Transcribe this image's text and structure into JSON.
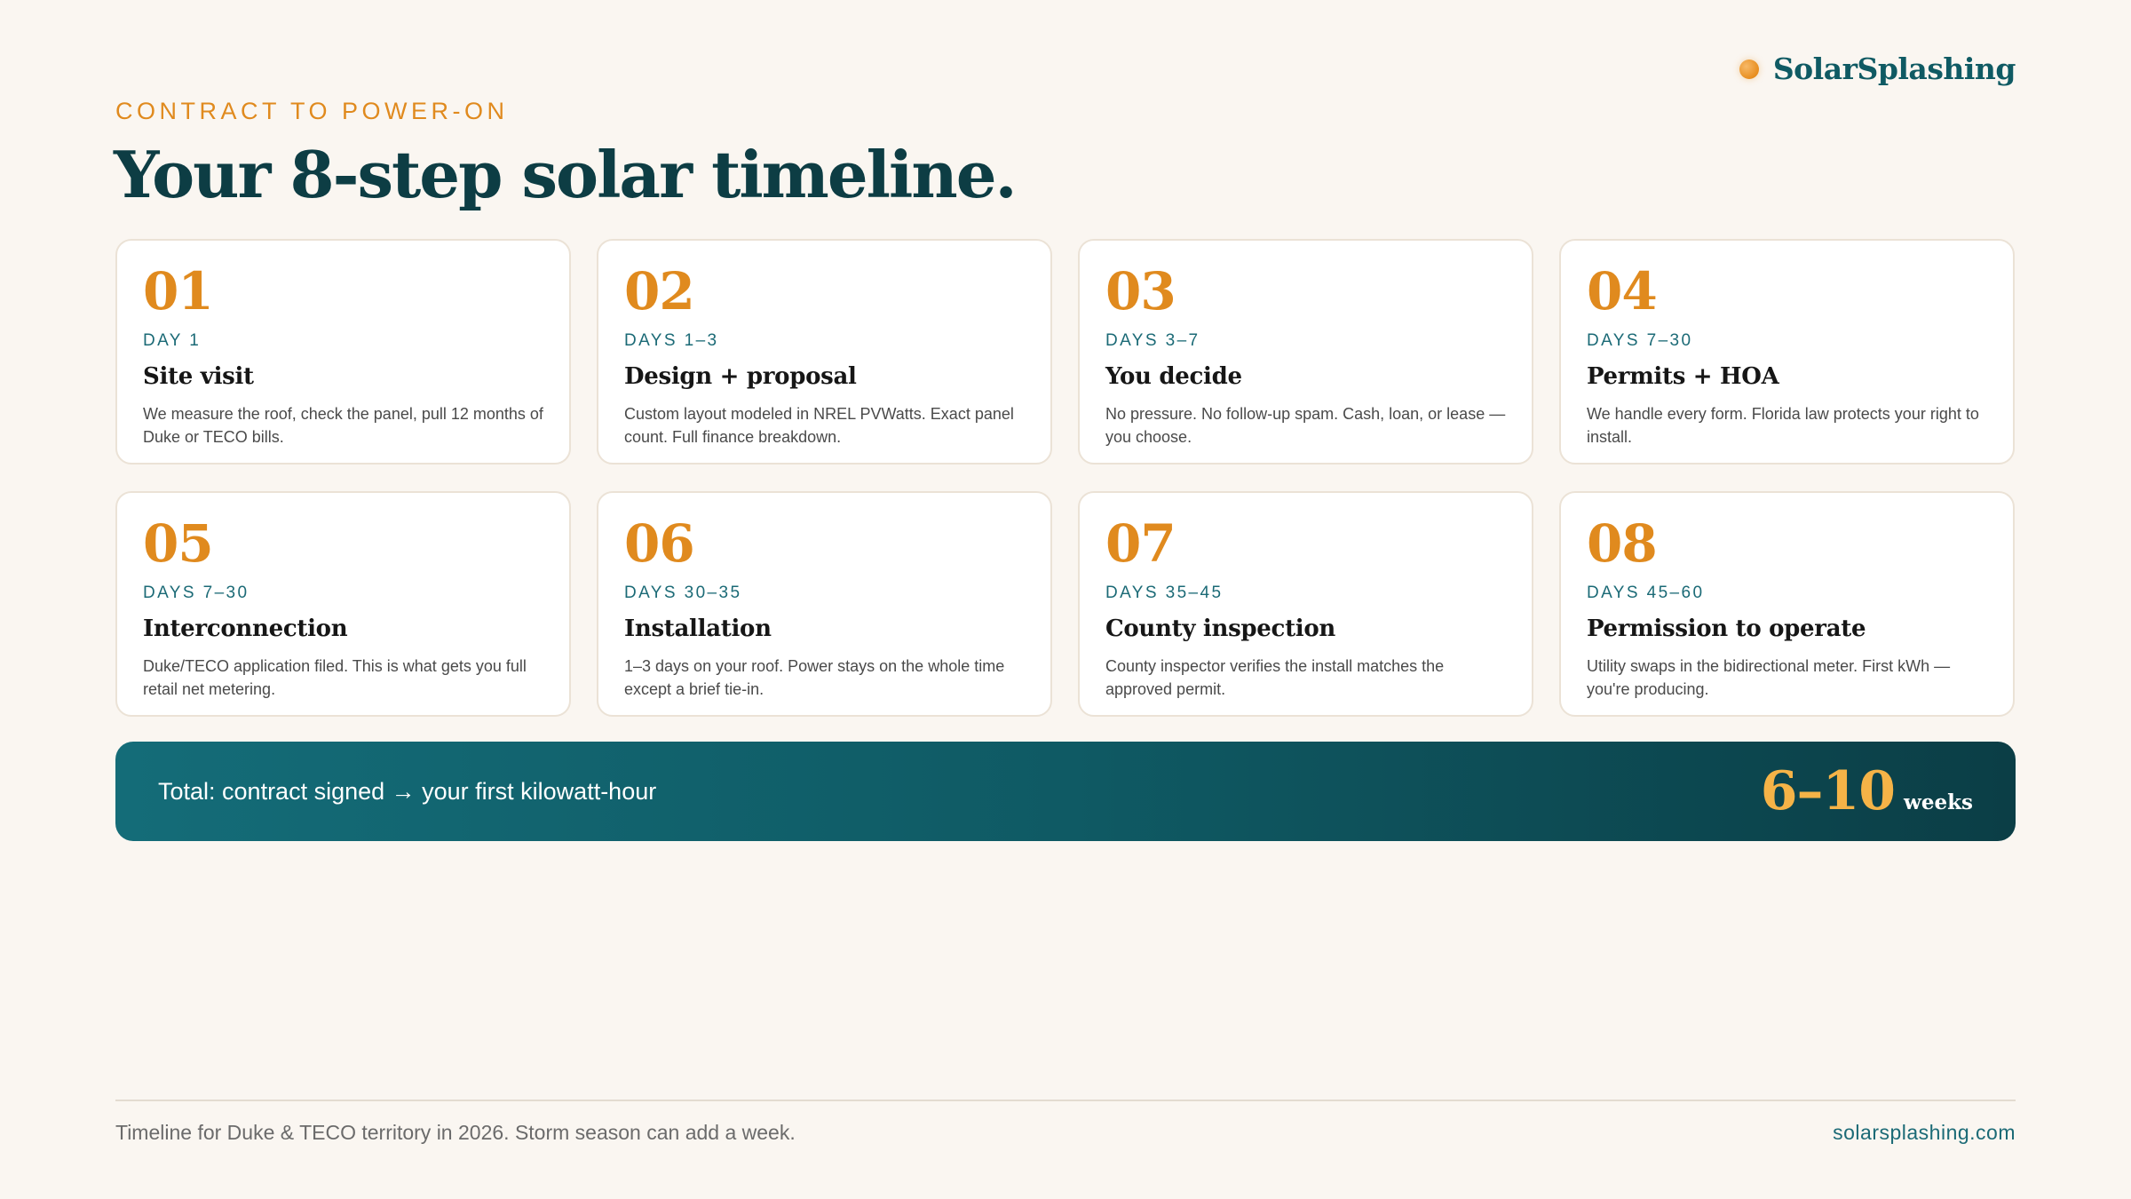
{
  "brand": {
    "name": "SolarSplashing",
    "icon": "sun-dot-icon",
    "accent_color": "#e08a1e"
  },
  "header": {
    "eyebrow": "CONTRACT TO POWER-ON",
    "title": "Your 8-step solar timeline."
  },
  "steps": [
    {
      "number": "01",
      "days": "DAY 1",
      "title": "Site visit",
      "description": "We measure the roof, check the panel, pull 12 months of Duke or TECO bills."
    },
    {
      "number": "02",
      "days": "DAYS 1–3",
      "title": "Design + proposal",
      "description": "Custom layout modeled in NREL PVWatts. Exact panel count. Full finance breakdown."
    },
    {
      "number": "03",
      "days": "DAYS 3–7",
      "title": "You decide",
      "description": "No pressure. No follow-up spam. Cash, loan, or lease — you choose."
    },
    {
      "number": "04",
      "days": "DAYS 7–30",
      "title": "Permits + HOA",
      "description": "We handle every form. Florida law protects your right to install."
    },
    {
      "number": "05",
      "days": "DAYS 7–30",
      "title": "Interconnection",
      "description": "Duke/TECO application filed. This is what gets you full retail net metering."
    },
    {
      "number": "06",
      "days": "DAYS 30–35",
      "title": "Installation",
      "description": "1–3 days on your roof. Power stays on the whole time except a brief tie-in."
    },
    {
      "number": "07",
      "days": "DAYS 35–45",
      "title": "County inspection",
      "description": "County inspector verifies the install matches the approved permit."
    },
    {
      "number": "08",
      "days": "DAYS 45–60",
      "title": "Permission to operate",
      "description": "Utility swaps in the bidirectional meter. First kWh — you're producing."
    }
  ],
  "total": {
    "label": "Total: contract signed → your first kilowatt-hour",
    "value": "6–10",
    "unit": "weeks"
  },
  "footer": {
    "note": "Timeline for Duke & TECO territory in 2026. Storm season can add a week.",
    "site": "solarsplashing.com"
  }
}
